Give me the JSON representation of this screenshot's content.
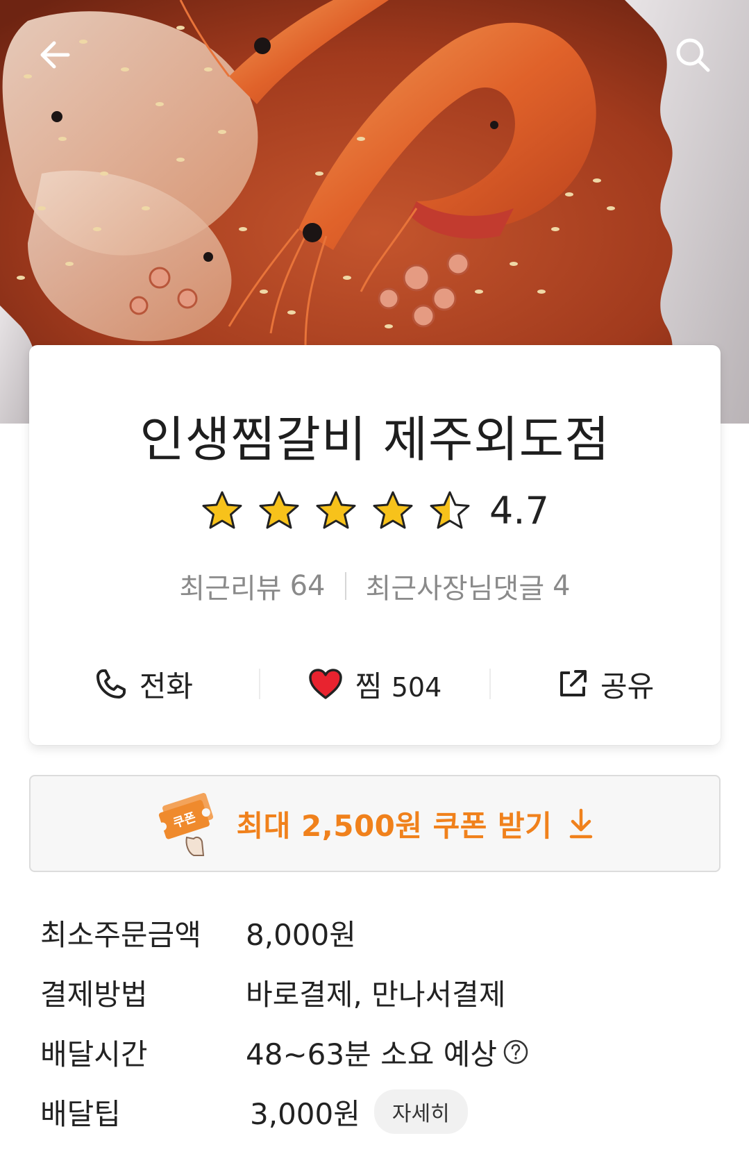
{
  "header": {
    "back_icon": "arrow-left-icon",
    "search_icon": "search-icon"
  },
  "store": {
    "name": "인생찜갈비 제주외도점",
    "rating": "4.7",
    "stars": {
      "filled": 4,
      "half": 1,
      "total": 5
    },
    "recent_reviews_label": "최근리뷰",
    "recent_reviews_count": "64",
    "owner_replies_label": "최근사장님댓글",
    "owner_replies_count": "4"
  },
  "actions": {
    "call_label": "전화",
    "call_icon": "phone-icon",
    "favorite_label": "찜",
    "favorite_count": "504",
    "favorite_icon": "heart-icon",
    "share_label": "공유",
    "share_icon": "share-icon"
  },
  "coupon": {
    "text": "최대 2,500원 쿠폰 받기",
    "badge_text": "쿠폰",
    "icon": "coupon-icon",
    "arrow_icon": "download-arrow-icon"
  },
  "info": {
    "min_order_label": "최소주문금액",
    "min_order_value": "8,000원",
    "payment_label": "결제방법",
    "payment_value": "바로결제, 만나서결제",
    "delivery_time_label": "배달시간",
    "delivery_time_value": "48~63분 소요 예상",
    "delivery_tip_label": "배달팁",
    "delivery_tip_value": "3,000원",
    "detail_button": "자세히"
  },
  "colors": {
    "accent_orange": "#f0811c",
    "star_yellow": "#f7c21b",
    "heart_red": "#e8232f",
    "text_gray": "#8a8a8a"
  }
}
